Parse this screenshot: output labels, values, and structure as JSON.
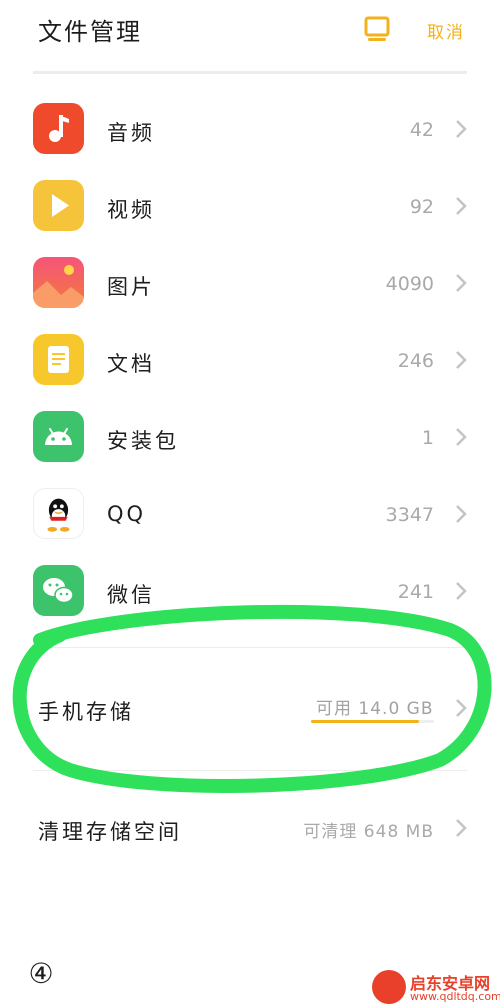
{
  "header": {
    "title": "文件管理",
    "header_icon": "screen-icon",
    "cancel_label": "取消",
    "accent_color": "#f2b21a"
  },
  "categories": [
    {
      "label": "音频",
      "count": "42",
      "icon": "music-note-icon",
      "color": "#ef4a2c"
    },
    {
      "label": "视频",
      "count": "92",
      "icon": "play-icon",
      "color": "#f5c43a"
    },
    {
      "label": "图片",
      "count": "4090",
      "icon": "mountain-sun-icon",
      "color": "#f1565f"
    },
    {
      "label": "文档",
      "count": "246",
      "icon": "document-icon",
      "color": "#f7c82b"
    },
    {
      "label": "安装包",
      "count": "1",
      "icon": "android-icon",
      "color": "#3dc36c"
    },
    {
      "label": "QQ",
      "count": "3347",
      "icon": "qq-penguin-icon",
      "color": "#ffffff"
    },
    {
      "label": "微信",
      "count": "241",
      "icon": "wechat-icon",
      "color": "#3dc36c"
    }
  ],
  "storage": {
    "label": "手机存储",
    "free_text": "可用 14.0 GB",
    "used_fraction": 0.88
  },
  "clean": {
    "label": "清理存储空间",
    "amount_text": "可清理 648 MB"
  },
  "annotation": {
    "step": "④",
    "circle_color": "#2ee05a"
  },
  "watermark": {
    "brand": "启东安卓网",
    "url": "www.qdltdq.com"
  }
}
